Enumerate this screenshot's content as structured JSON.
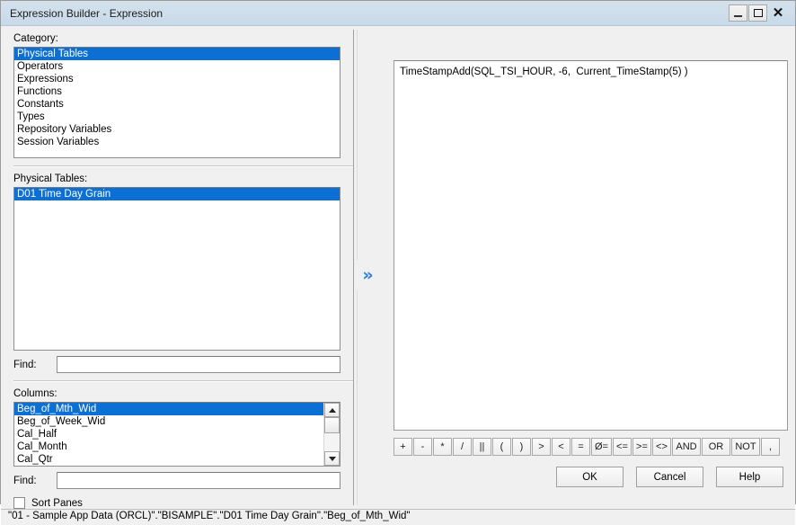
{
  "window": {
    "title": "Expression Builder - Expression",
    "controls": {
      "minimize": "minimize-icon",
      "maximize": "maximize-icon",
      "close": "close-icon"
    }
  },
  "left": {
    "category": {
      "label": "Category:",
      "items": [
        {
          "label": "Physical Tables",
          "selected": true
        },
        {
          "label": "Operators",
          "selected": false
        },
        {
          "label": "Expressions",
          "selected": false
        },
        {
          "label": "Functions",
          "selected": false
        },
        {
          "label": "Constants",
          "selected": false
        },
        {
          "label": "Types",
          "selected": false
        },
        {
          "label": "Repository Variables",
          "selected": false
        },
        {
          "label": "Session Variables",
          "selected": false
        }
      ]
    },
    "physical_tables": {
      "label": "Physical Tables:",
      "items": [
        {
          "label": "D01 Time Day Grain",
          "selected": true
        }
      ],
      "find_label": "Find:",
      "find_value": "",
      "find_placeholder": ""
    },
    "columns": {
      "label": "Columns:",
      "items": [
        {
          "label": "Beg_of_Mth_Wid",
          "selected": true
        },
        {
          "label": "Beg_of_Week_Wid",
          "selected": false
        },
        {
          "label": "Cal_Half",
          "selected": false
        },
        {
          "label": "Cal_Month",
          "selected": false
        },
        {
          "label": "Cal_Qtr",
          "selected": false
        }
      ],
      "find_label": "Find:",
      "find_value": "",
      "find_placeholder": "",
      "scroll_up_icon": "triangle-up-icon",
      "scroll_down_icon": "triangle-down-icon"
    },
    "sort_panes": {
      "label": "Sort Panes",
      "checked": false
    }
  },
  "transfer": {
    "icon": "double-chevron-right-icon",
    "color": "#2e7fd4"
  },
  "right": {
    "expression": {
      "value": "TimeStampAdd(SQL_TSI_HOUR, -6,  Current_TimeStamp(5) )",
      "placeholder": ""
    },
    "operators": [
      {
        "label": "+",
        "name": "plus"
      },
      {
        "label": "-",
        "name": "minus"
      },
      {
        "label": "*",
        "name": "multiply"
      },
      {
        "label": "/",
        "name": "divide"
      },
      {
        "label": "||",
        "name": "concat"
      },
      {
        "label": "(",
        "name": "paren-open"
      },
      {
        "label": ")",
        "name": "paren-close"
      },
      {
        "label": ">",
        "name": "greater-than"
      },
      {
        "label": "<",
        "name": "less-than"
      },
      {
        "label": "=",
        "name": "equals"
      },
      {
        "label": "Ø=",
        "name": "not-equals"
      },
      {
        "label": "<=",
        "name": "less-or-equal"
      },
      {
        "label": ">=",
        "name": "greater-or-equal"
      },
      {
        "label": "<>",
        "name": "diamond-not-equal"
      },
      {
        "label": "AND",
        "name": "and"
      },
      {
        "label": "OR",
        "name": "or"
      },
      {
        "label": "NOT",
        "name": "not"
      },
      {
        "label": ",",
        "name": "comma"
      }
    ],
    "actions": {
      "ok": "OK",
      "cancel": "Cancel",
      "help": "Help"
    }
  },
  "statusbar": {
    "text": "\"01 - Sample App Data (ORCL)\".\"BISAMPLE\".\"D01 Time Day Grain\".\"Beg_of_Mth_Wid\""
  },
  "colors": {
    "selection": "#0c6fd4",
    "titlebar": "#cedeeb",
    "dialog": "#f0f0f0"
  }
}
